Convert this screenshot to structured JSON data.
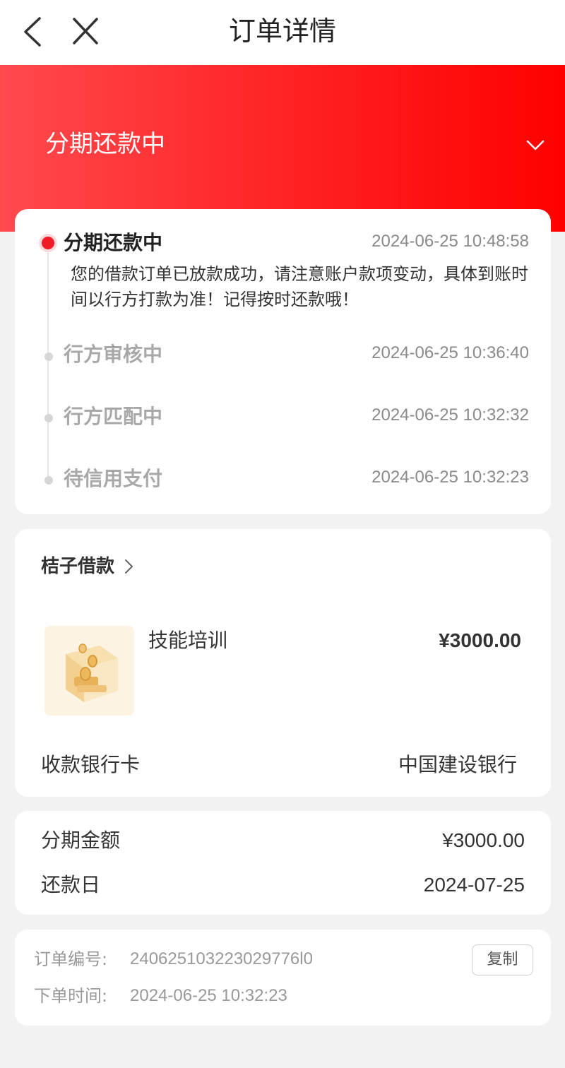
{
  "header": {
    "title": "订单详情",
    "back_icon": "chevron-left-icon",
    "close_icon": "close-icon"
  },
  "banner": {
    "status": "分期还款中",
    "expand_icon": "chevron-down-icon",
    "colors": {
      "start": "#ff4a4f",
      "end": "#ff0000"
    }
  },
  "timeline": {
    "steps": [
      {
        "title": "分期还款中",
        "time": "2024-06-25 10:48:58",
        "active": true,
        "desc": "您的借款订单已放款成功，请注意账户款项变动，具体到账时间以行方打款为准！记得按时还款哦！"
      },
      {
        "title": "行方审核中",
        "time": "2024-06-25 10:36:40",
        "active": false
      },
      {
        "title": "行方匹配中",
        "time": "2024-06-25 10:32:32",
        "active": false
      },
      {
        "title": "待信用支付",
        "time": "2024-06-25 10:32:23",
        "active": false
      }
    ],
    "active_color": "#ee1c25"
  },
  "product": {
    "merchant": "桔子借款",
    "name": "技能培训",
    "price": "¥3000.00",
    "bank_label": "收款银行卡",
    "bank_value": "中国建设银行",
    "thumb_icon": "coin-box-icon"
  },
  "amounts": {
    "installment_label": "分期金额",
    "installment_value": "¥3000.00",
    "due_label": "还款日",
    "due_value": "2024-07-25"
  },
  "order": {
    "number_label": "订单编号:",
    "number_value": "240625103223029776l0",
    "time_label": "下单时间:",
    "time_value": "2024-06-25 10:32:23",
    "copy_label": "复制"
  }
}
